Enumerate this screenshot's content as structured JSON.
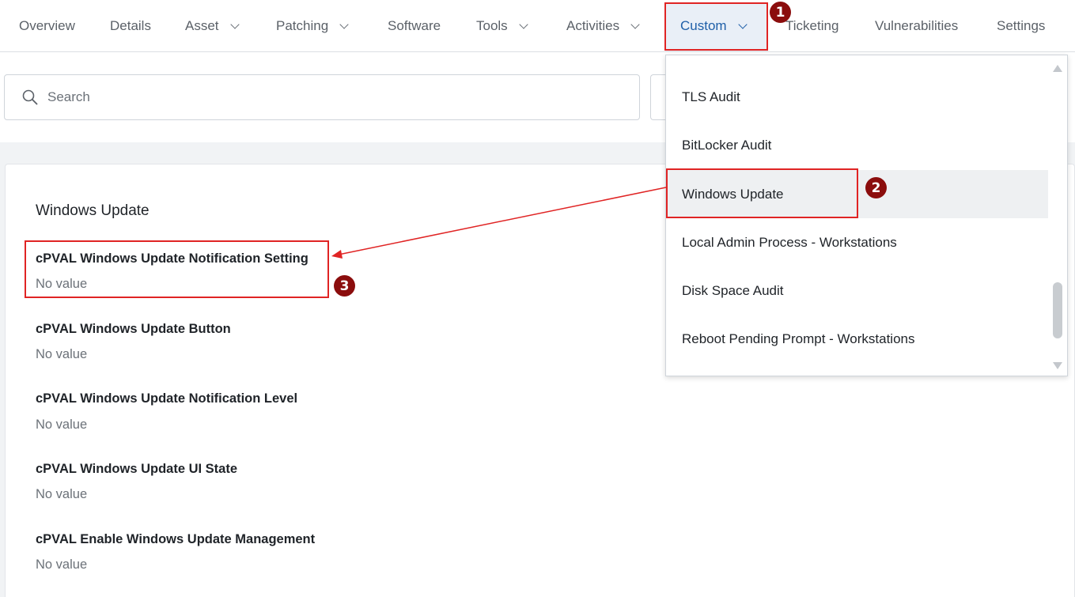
{
  "nav": {
    "tabs": [
      {
        "label": "Overview",
        "has_dropdown": false
      },
      {
        "label": "Details",
        "has_dropdown": false
      },
      {
        "label": "Asset",
        "has_dropdown": true
      },
      {
        "label": "Patching",
        "has_dropdown": true
      },
      {
        "label": "Software",
        "has_dropdown": false
      },
      {
        "label": "Tools",
        "has_dropdown": true
      },
      {
        "label": "Activities",
        "has_dropdown": true
      },
      {
        "label": "Custom",
        "has_dropdown": true,
        "active": true
      },
      {
        "label": "Ticketing",
        "has_dropdown": false
      },
      {
        "label": "Vulnerabilities",
        "has_dropdown": false
      },
      {
        "label": "Settings",
        "has_dropdown": false
      }
    ]
  },
  "search": {
    "placeholder": "Search",
    "icon": "search-icon"
  },
  "section": {
    "title": "Windows Update",
    "fields": [
      {
        "label": "cPVAL Windows Update Notification Setting",
        "value": "No value"
      },
      {
        "label": "cPVAL Windows Update Button",
        "value": "No value"
      },
      {
        "label": "cPVAL Windows Update Notification Level",
        "value": "No value"
      },
      {
        "label": "cPVAL Windows Update UI State",
        "value": "No value"
      },
      {
        "label": "cPVAL Enable Windows Update Management",
        "value": "No value"
      }
    ]
  },
  "dropdown": {
    "items": [
      {
        "label": "TLS Audit"
      },
      {
        "label": "BitLocker Audit"
      },
      {
        "label": "Windows Update",
        "hovered": true
      },
      {
        "label": "Local Admin Process - Workstations"
      },
      {
        "label": "Disk Space Audit"
      },
      {
        "label": "Reboot Pending Prompt - Workstations"
      }
    ]
  },
  "annotations": {
    "badges": [
      "1",
      "2",
      "3"
    ],
    "color": "#e02424",
    "badge_color": "#8b0d0d"
  },
  "colors": {
    "accent": "#1f5fa8",
    "active_tab_bg": "#e9eff7",
    "page_band": "#f1f3f5"
  }
}
